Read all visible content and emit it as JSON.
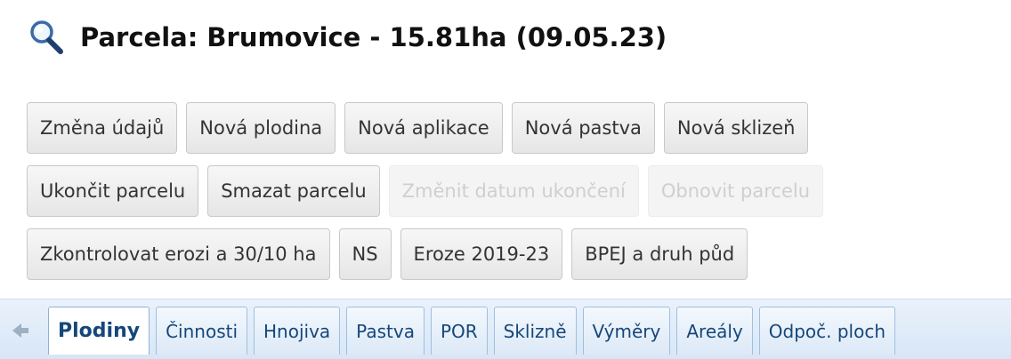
{
  "header": {
    "icon": "magnifier-icon",
    "title": "Parcela: Brumovice - 15.81ha (09.05.23)"
  },
  "buttons": {
    "row1": [
      "Změna údajů",
      "Nová plodina",
      "Nová aplikace",
      "Nová pastva",
      "Nová sklizeň"
    ],
    "row2": [
      "Ukončit parcelu",
      "Smazat parcelu",
      "Změnit datum ukončení",
      "Obnovit parcelu"
    ],
    "row3": [
      "Zkontrolovat erozi a 30/10 ha",
      "NS",
      "Eroze 2019-23",
      "BPEJ a druh půd"
    ],
    "disabled": [
      "Změnit datum ukončení",
      "Obnovit parcelu"
    ]
  },
  "tabs": {
    "scroll_left_icon": "arrow-left-icon",
    "items": [
      "Plodiny",
      "Činnosti",
      "Hnojiva",
      "Pastva",
      "POR",
      "Sklizně",
      "Výměry",
      "Areály",
      "Odpoč. ploch"
    ],
    "active": "Plodiny"
  },
  "colors": {
    "tab_text": "#16477a",
    "tabstrip_bg": "#dfeaf7",
    "disabled_text": "#cfcfcf"
  }
}
